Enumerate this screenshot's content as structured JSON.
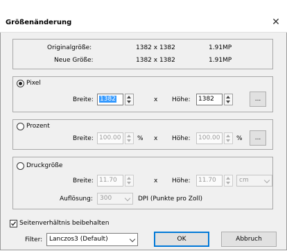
{
  "window": {
    "title": "Größenänderung",
    "close_glyph": "✕"
  },
  "info": {
    "original_label": "Originalgröße:",
    "original_dims": "1382 x 1382",
    "original_mp": "1.91MP",
    "new_label": "Neue Größe:",
    "new_dims": "1382 x 1382",
    "new_mp": "1.91MP"
  },
  "pixel": {
    "radio_label": "Pixel",
    "width_label": "Breite:",
    "width_value": "1382",
    "x_sep": "x",
    "height_label": "Höhe:",
    "height_value": "1382",
    "more_label": "..."
  },
  "percent": {
    "radio_label": "Prozent",
    "width_label": "Breite:",
    "width_value": "100.00",
    "width_unit": "%",
    "x_sep": "x",
    "height_label": "Höhe:",
    "height_value": "100.00",
    "height_unit": "%",
    "more_label": "..."
  },
  "print": {
    "radio_label": "Druckgröße",
    "width_label": "Breite:",
    "width_value": "11.70",
    "x_sep": "x",
    "height_label": "Höhe:",
    "height_value": "11.70",
    "unit_value": "cm",
    "resolution_label": "Auflösung:",
    "resolution_value": "300",
    "dpi_label": "DPI (Punkte pro Zoll)"
  },
  "keep_ratio": {
    "label": "Seitenverhältnis beibehalten",
    "checked": true
  },
  "footer": {
    "filter_label": "Filter:",
    "filter_value": "Lanczos3 (Default)",
    "ok_label": "OK",
    "cancel_label": "Abbruch"
  },
  "icons": {
    "close": "close-icon",
    "spinner": "spinner-arrows-icon",
    "dropdown": "chevron-down-icon",
    "check": "checkmark-icon"
  },
  "colors": {
    "selection": "#3399ff",
    "dialog_bg": "#f0f0f0",
    "ok_border": "#0078d7"
  }
}
